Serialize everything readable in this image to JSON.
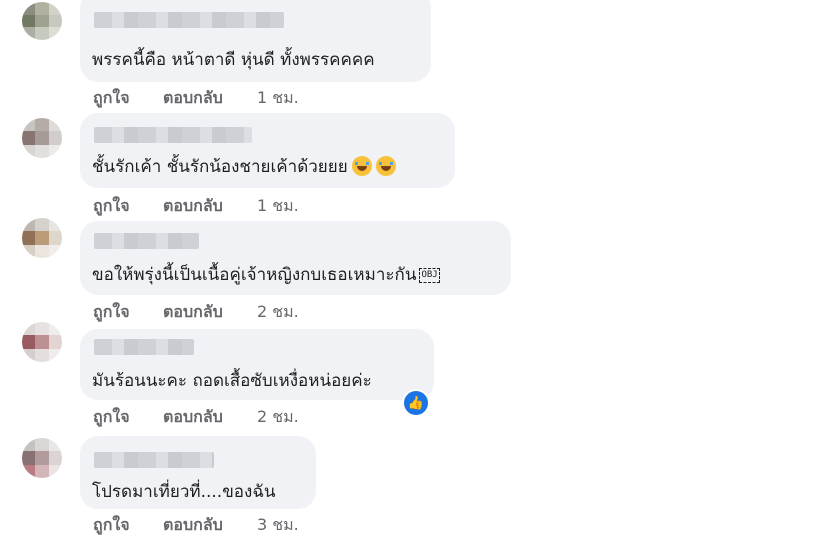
{
  "comments": [
    {
      "text": "พรรคนี้คือ หน้าตาดี หุ่นดี ทั้งพรรคคคค",
      "like_label": "ถูกใจ",
      "reply_label": "ตอบกลับ",
      "time": "1 ชม."
    },
    {
      "text": "ชั้นรักเค้า ชั้นรักน้องชายเค้าด้วยยย",
      "emojis": [
        "face-with-tears-of-joy",
        "face-with-tears-of-joy"
      ],
      "like_label": "ถูกใจ",
      "reply_label": "ตอบกลับ",
      "time": "1 ชม."
    },
    {
      "text": "ขอให้พรุ่งนี้เป็นเนื้อคู่เจ้าหญิงกบเธอเหมาะกัน",
      "obj_glyph": "OBJ",
      "like_label": "ถูกใจ",
      "reply_label": "ตอบกลับ",
      "time": "2 ชม."
    },
    {
      "text": "มันร้อนนะคะ ถอดเสื้อซับเหงื่อหน่อยค่ะ",
      "reaction": "like",
      "reaction_icon": "thumbs-up-icon",
      "like_label": "ถูกใจ",
      "reply_label": "ตอบกลับ",
      "time": "2 ชม."
    },
    {
      "text": "โปรดมาเที่ยวที่....ของฉัน",
      "like_label": "ถูกใจ",
      "reply_label": "ตอบกลับ",
      "time": "3 ชม."
    }
  ],
  "colors": {
    "bubble": "#f0f2f5",
    "text": "#1c1e21",
    "meta": "#65676b",
    "like_blue": "#1b74e4"
  }
}
